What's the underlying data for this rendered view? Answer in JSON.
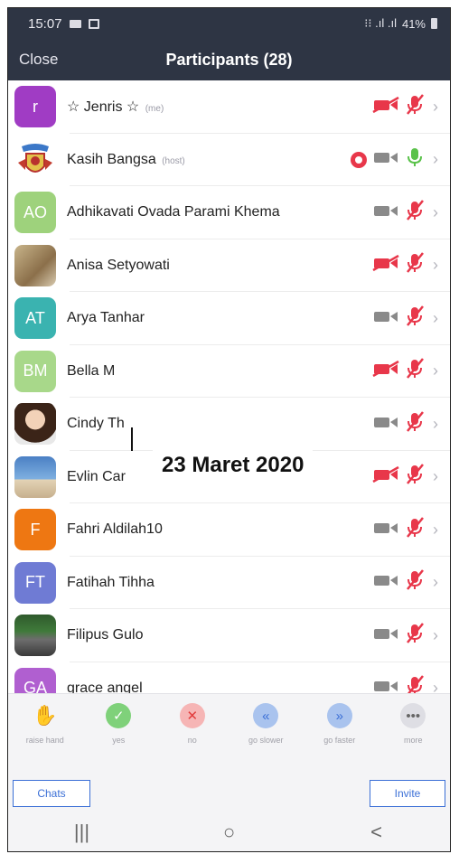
{
  "status_bar": {
    "time": "15:07",
    "battery": "41%"
  },
  "header": {
    "close_label": "Close",
    "title": "Participants (28)"
  },
  "participants": [
    {
      "initials": "r",
      "avatar_color": "#a03cc4",
      "name": "☆ Jenris ☆",
      "tag": "(me)",
      "video": "off",
      "mic": "off"
    },
    {
      "initials": "",
      "avatar_color": "emblem",
      "name": "Kasih Bangsa",
      "tag": "(host)",
      "recording": true,
      "video": "on",
      "mic": "on"
    },
    {
      "initials": "AO",
      "avatar_color": "#9ed27c",
      "name": "Adhikavati Ovada Parami Khema",
      "tag": "",
      "video": "on",
      "mic": "off"
    },
    {
      "initials": "",
      "avatar_color": "photo1",
      "name": "Anisa Setyowati",
      "tag": "",
      "video": "off",
      "mic": "off"
    },
    {
      "initials": "AT",
      "avatar_color": "#3ab3b0",
      "name": "Arya Tanhar",
      "tag": "",
      "video": "on",
      "mic": "off"
    },
    {
      "initials": "BM",
      "avatar_color": "#a8d88a",
      "name": "Bella M",
      "tag": "",
      "video": "off",
      "mic": "off"
    },
    {
      "initials": "",
      "avatar_color": "photo2",
      "name": "Cindy Th",
      "tag": "",
      "video": "on",
      "mic": "off"
    },
    {
      "initials": "",
      "avatar_color": "photo3",
      "name": "Evlin Car",
      "tag": "",
      "video": "off",
      "mic": "off"
    },
    {
      "initials": "F",
      "avatar_color": "#ee7712",
      "name": "Fahri Aldilah10",
      "tag": "",
      "video": "on",
      "mic": "off"
    },
    {
      "initials": "FT",
      "avatar_color": "#6f7bd4",
      "name": "Fatihah Tihha",
      "tag": "",
      "video": "on",
      "mic": "off"
    },
    {
      "initials": "",
      "avatar_color": "photo4",
      "name": "Filipus Gulo",
      "tag": "",
      "video": "on",
      "mic": "off"
    },
    {
      "initials": "GA",
      "avatar_color": "#b05fd0",
      "name": "grace angel",
      "tag": "",
      "video": "on",
      "mic": "off"
    }
  ],
  "overlay_text": "23 Maret 2020",
  "reactions": [
    {
      "label": "raise hand",
      "icon": "raise-hand-icon",
      "glyph": "✋",
      "bg": "transparent",
      "fg": "#f0a24a"
    },
    {
      "label": "yes",
      "icon": "check-icon",
      "glyph": "✓",
      "bg": "#7fd17a",
      "fg": "#ffffff"
    },
    {
      "label": "no",
      "icon": "x-icon",
      "glyph": "✕",
      "bg": "#f6b5b5",
      "fg": "#e23b3b"
    },
    {
      "label": "go slower",
      "icon": "go-slower-icon",
      "glyph": "«",
      "bg": "#a9c3ee",
      "fg": "#3b6fd6"
    },
    {
      "label": "go faster",
      "icon": "go-faster-icon",
      "glyph": "»",
      "bg": "#a9c3ee",
      "fg": "#3b6fd6"
    },
    {
      "label": "more",
      "icon": "more-icon",
      "glyph": "•••",
      "bg": "#dedee4",
      "fg": "#666666"
    }
  ],
  "buttons": {
    "chats": "Chats",
    "invite": "Invite"
  },
  "nav": {
    "recents": "|||",
    "home": "○",
    "back": "<"
  },
  "colors": {
    "header_bg": "#2e3544",
    "muted_red": "#e8374a",
    "video_gray": "#8a8a8a",
    "mic_green": "#5ac24a"
  }
}
